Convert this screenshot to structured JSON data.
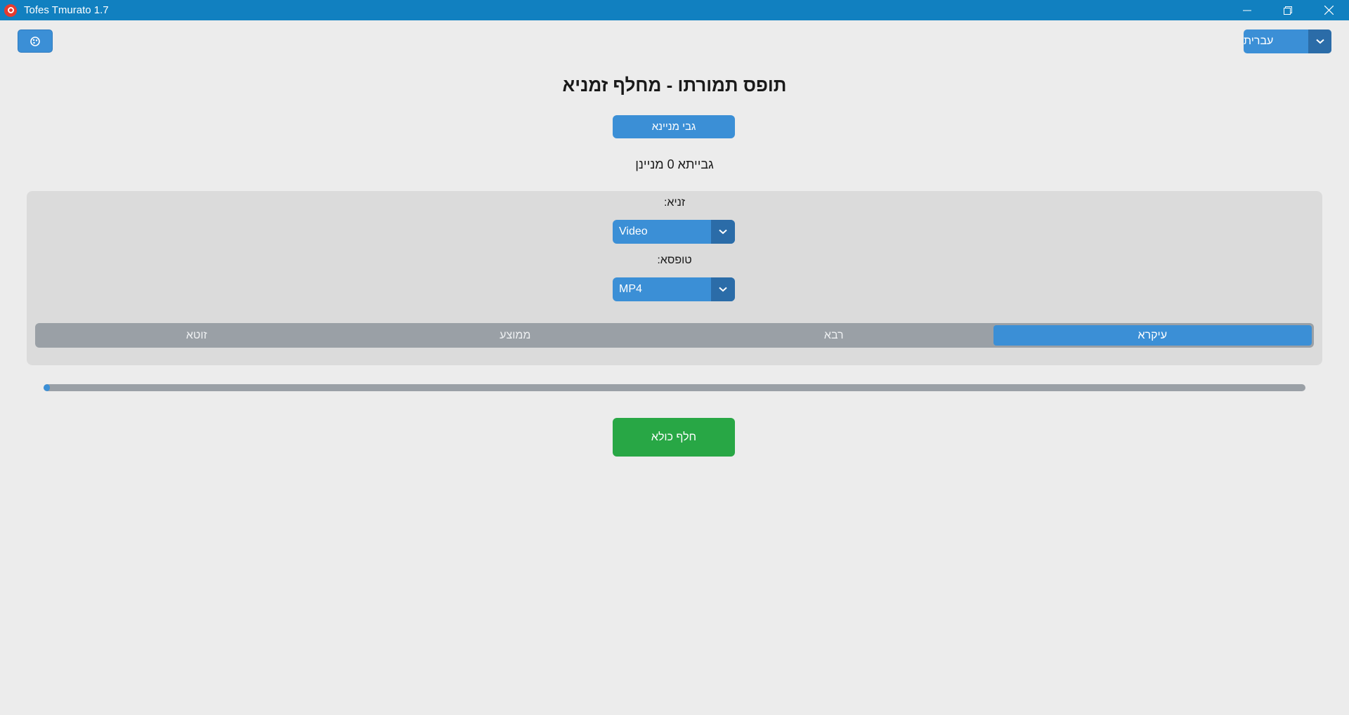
{
  "window": {
    "title": "Tofes Tmurato 1.7",
    "controls": [
      "minimize-icon",
      "restore-icon",
      "close-icon"
    ]
  },
  "header": {
    "theme_icon": "palette-icon",
    "language": {
      "selected": "עברית",
      "arrow_icon": "chevron-down-icon"
    }
  },
  "main": {
    "title": "תופס תמורתו - מחלף זמניא",
    "collect_button": "גבי מניינא",
    "collected_status": "גבייתא 0 מניינן"
  },
  "settings": {
    "type_label": "זניא:",
    "type_selected": "Video",
    "format_label": "טופסא:",
    "format_selected": "MP4",
    "quality_options": [
      {
        "label": "עיקרא",
        "active": true
      },
      {
        "label": "רבא",
        "active": false
      },
      {
        "label": "ממוצע",
        "active": false
      },
      {
        "label": "זוטא",
        "active": false
      }
    ]
  },
  "progress": {
    "value_percent": 0.5
  },
  "actions": {
    "convert_all": "חלף כולא"
  },
  "colors": {
    "titlebar": "#1180c0",
    "accent": "#3b8fd6",
    "accent_dark": "#2b6ca8",
    "success": "#28a745"
  }
}
